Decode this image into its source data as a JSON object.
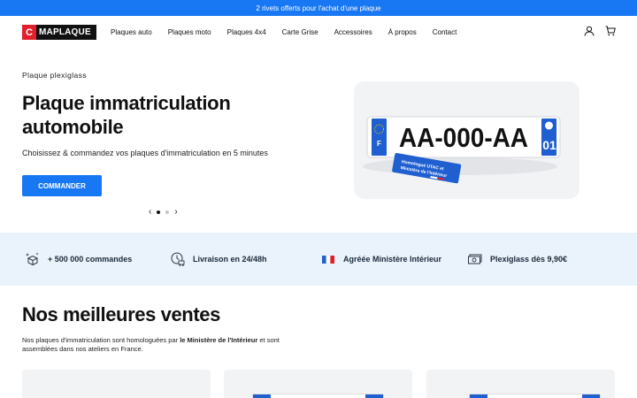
{
  "topbar": {
    "promo": "2 rivets offerts pour l'achat d'une plaque"
  },
  "header": {
    "logo_mark": "C",
    "logo_text": "MAPLAQUE",
    "nav": [
      "Plaques auto",
      "Plaques moto",
      "Plaques 4x4",
      "Carte Grise",
      "Accessoires",
      "À propos",
      "Contact"
    ],
    "icons": [
      "user-icon",
      "cart-icon"
    ]
  },
  "hero": {
    "kicker": "Plaque plexiglass",
    "title": "Plaque immatriculation automobile",
    "subtitle": "Choisissez & commandez vos plaques d'immatriculation en 5 minutes",
    "cta": "COMMANDER",
    "carousel": {
      "slides": 2,
      "active": 1
    },
    "plate": {
      "number": "AA-000-AA",
      "country": "F",
      "dept": "01",
      "tag_line1": "Homologué UTAC et",
      "tag_line2": "Ministère de l'Intérieur"
    }
  },
  "features": [
    {
      "icon": "box-stars-icon",
      "label": "+ 500 000 commandes"
    },
    {
      "icon": "delivery-clock-icon",
      "label": "Livraison en 24/48h"
    },
    {
      "icon": "french-flag-icon",
      "label": "Agréée Ministère Intérieur"
    },
    {
      "icon": "money-icon",
      "label": "Plexiglass dès 9,90€"
    }
  ],
  "best_sellers": {
    "title": "Nos meilleures ventes",
    "desc_prefix": "Nos plaques d'immatriculation sont homologuées par ",
    "desc_bold": "le Ministère de l'Intérieur",
    "desc_suffix": " et sont assemblées dans nos ateliers en France."
  },
  "colors": {
    "accent": "#1877f2",
    "logo_red": "#e0202c",
    "plate_blue": "#1f5fd0",
    "band_bg": "#eaf2fb"
  }
}
